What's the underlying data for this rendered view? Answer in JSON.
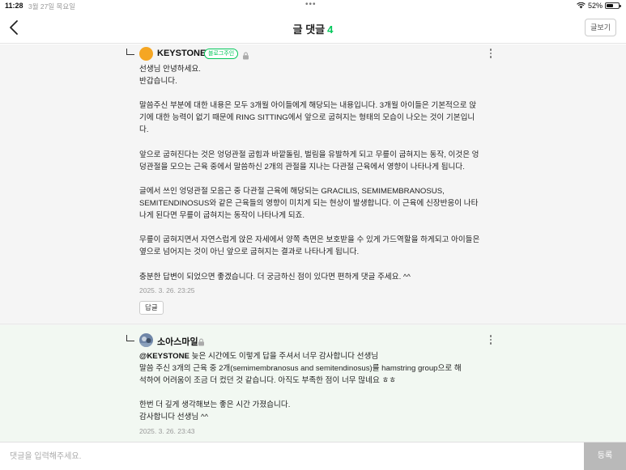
{
  "status_bar": {
    "time": "11:28",
    "date": "3월 27일 목요일",
    "dots": "•••",
    "battery": "52%",
    "battery_level": 0.52
  },
  "header": {
    "title": "글 댓글",
    "count": "4",
    "view_post_label": "글보기"
  },
  "comments": [
    {
      "nickname": "KEYSTONE",
      "badge": "블로그주인",
      "lines": [
        "선생님 안녕하세요.",
        "반갑습니다.",
        "",
        "말씀주신 부분에 대한 내용은 모두 3개월 아이들에게 해당되는 내용입니다. 3개월 아이들은 기본적으로 앉",
        "기에 대한 능력이 없기 때문에 RING SITTING에서 앞으로 굽혀지는 형태의 모습이 나오는 것이 기본입니",
        "다.",
        "",
        "앞으로 굽혀진다는 것은 엉덩관절 굽힘과 바깥돌림, 벌림을 유발하게 되고 무릎이 굽혀지는 동작, 이것은 엉",
        "덩관절을 모으는 근육 중에서 말씀하신 2개의 관절을 지나는 다관절 근육에서 영향이 나타나게 됩니다.",
        "",
        "글에서 쓰인 엉덩관절 모음근 중 다관절 근육에 해당되는 GRACILIS, SEMIMEMBRANOSUS,",
        "SEMITENDINOSUS와 같은 근육들의 영향이 미치게 되는 현상이 발생합니다. 이 근육에 신장반응이 나타",
        "나게 된다면 무릎이 굽혀지는 동작이 나타나게 되죠.",
        "",
        "무릎이 굽혀지면서 자연스럽게 앉은 자세에서 양쪽 측면은 보호받을 수 있게 가드역할을 하게되고 아이들은",
        "옆으로 넘어지는 것이 아닌 앞으로 굽혀지는 결과로 나타나게 됩니다.",
        "",
        "충분한 답변이 되었으면 좋겠습니다. 더 궁금하신 점이 있다면 편하게 댓글 주세요. ^^"
      ],
      "date": "2025. 3. 26. 23:25",
      "reply_label": "답글"
    },
    {
      "nickname": "소아스마일",
      "mention": "@KEYSTONE",
      "lines": [
        " 늦은 시간에도 이렇게 답을 주셔서 너무 감사합니다 선생님",
        "말씀 주신 3개의 근육 중 2개(semimembranosus and semitendinosus)를 hamstring group으로 해",
        "석하여 어려움이 조금 더 컸던 것 같습니다. 아직도 부족한 점이 너무 많네요 ㅎㅎ",
        "",
        "한번 더 깊게 생각해보는 좋은 시간 가졌습니다.",
        "감사합니다 선생님 ^^"
      ],
      "date": "2025. 3. 26. 23:43"
    }
  ],
  "comment_input": {
    "placeholder": "댓글을 입력해주세요.",
    "submit_label": "등록"
  }
}
